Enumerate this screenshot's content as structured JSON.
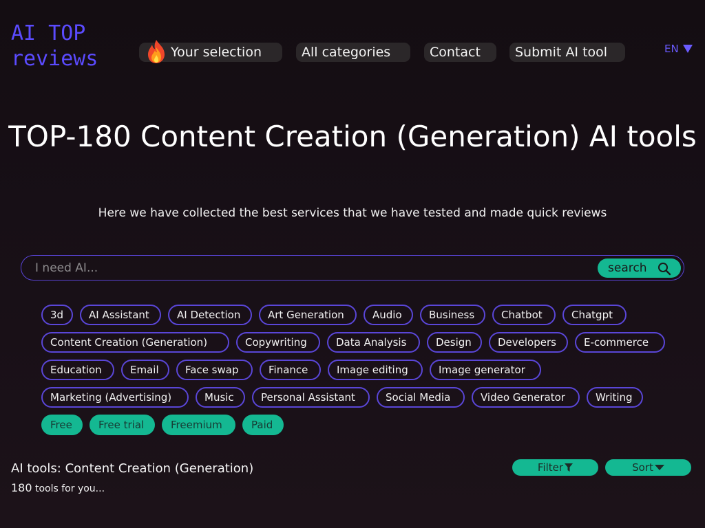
{
  "logo": {
    "line1": "AI TOP",
    "line2": "reviews"
  },
  "nav": {
    "your_selection": "Your selection",
    "all_categories": "All categories",
    "contact": "Contact",
    "submit": "Submit AI tool"
  },
  "lang": "EN",
  "heading": "TOP-180 Content Creation (Generation) AI tools",
  "subtitle": "Here we have collected the best services that we have tested and made quick reviews",
  "search": {
    "placeholder": "I need AI...",
    "button": "search"
  },
  "tags": [
    "3d",
    "AI Assistant",
    "AI Detection",
    "Art Generation",
    "Audio",
    "Business",
    "Chatbot",
    "Chatgpt",
    "Content Creation (Generation)",
    "Copywriting",
    "Data Analysis",
    "Design",
    "Developers",
    "E-commerce",
    "Education",
    "Email",
    "Face swap",
    "Finance",
    "Image editing",
    "Image generator",
    "Marketing (Advertising)",
    "Music",
    "Personal Assistant",
    "Social Media",
    "Video Generator",
    "Writing"
  ],
  "pricing": [
    "Free",
    "Free trial",
    "Freemium",
    "Paid"
  ],
  "results": {
    "title": "AI tools: Content Creation (Generation)",
    "count": "180",
    "count_suffix": " tools for you..."
  },
  "actions": {
    "filter": "Filter",
    "sort": "Sort"
  },
  "colors": {
    "accent_purple": "#5b4bff",
    "tag_border": "#5a46d8",
    "accent_green": "#14b892"
  }
}
